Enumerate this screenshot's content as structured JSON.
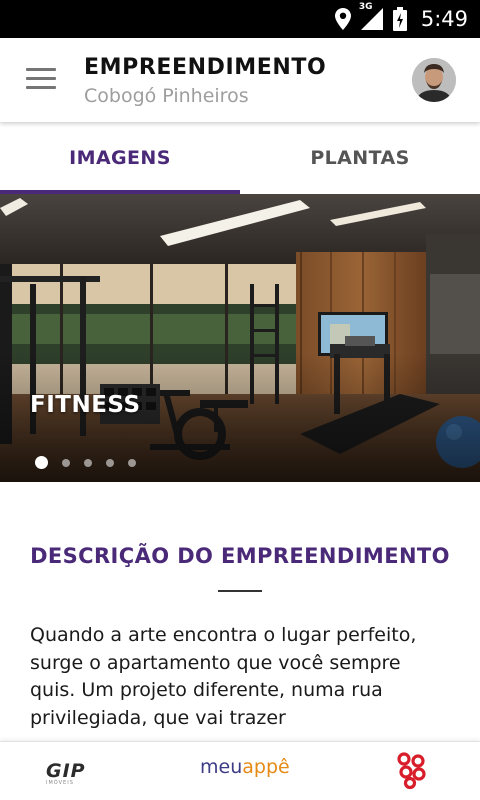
{
  "status_bar": {
    "network": "3G",
    "time": "5:49",
    "icons": [
      "location-icon",
      "signal-icon",
      "battery-icon"
    ]
  },
  "app_bar": {
    "menu_icon": "hamburger-menu-icon",
    "title": "EMPREENDIMENTO",
    "subtitle": "Cobogó Pinheiros"
  },
  "tabs": [
    {
      "label": "IMAGENS",
      "active": true
    },
    {
      "label": "PLANTAS",
      "active": false
    }
  ],
  "gallery": {
    "caption": "FITNESS",
    "total_slides": 5,
    "current_slide": 1
  },
  "description": {
    "title": "DESCRIÇÃO DO EMPREENDIMENTO",
    "body": "Quando a arte encontra o lugar perfeito, surge o apartamento que você sempre quis. Um projeto diferente, numa rua privilegiada, que vai trazer"
  },
  "footer": {
    "logos": {
      "gip": {
        "text": "GIP",
        "subtext": "IMÓVEIS"
      },
      "meuappe": {
        "prefix": "meu",
        "suffix": "appê"
      },
      "cobogo": {
        "name": "cobogó-logo"
      }
    }
  },
  "colors": {
    "accent": "#4a2a78",
    "status_bar": "#000000",
    "meuappe_blue": "#3b3b86",
    "meuappe_orange": "#e58a16",
    "cobogo_red": "#d81e2b"
  }
}
